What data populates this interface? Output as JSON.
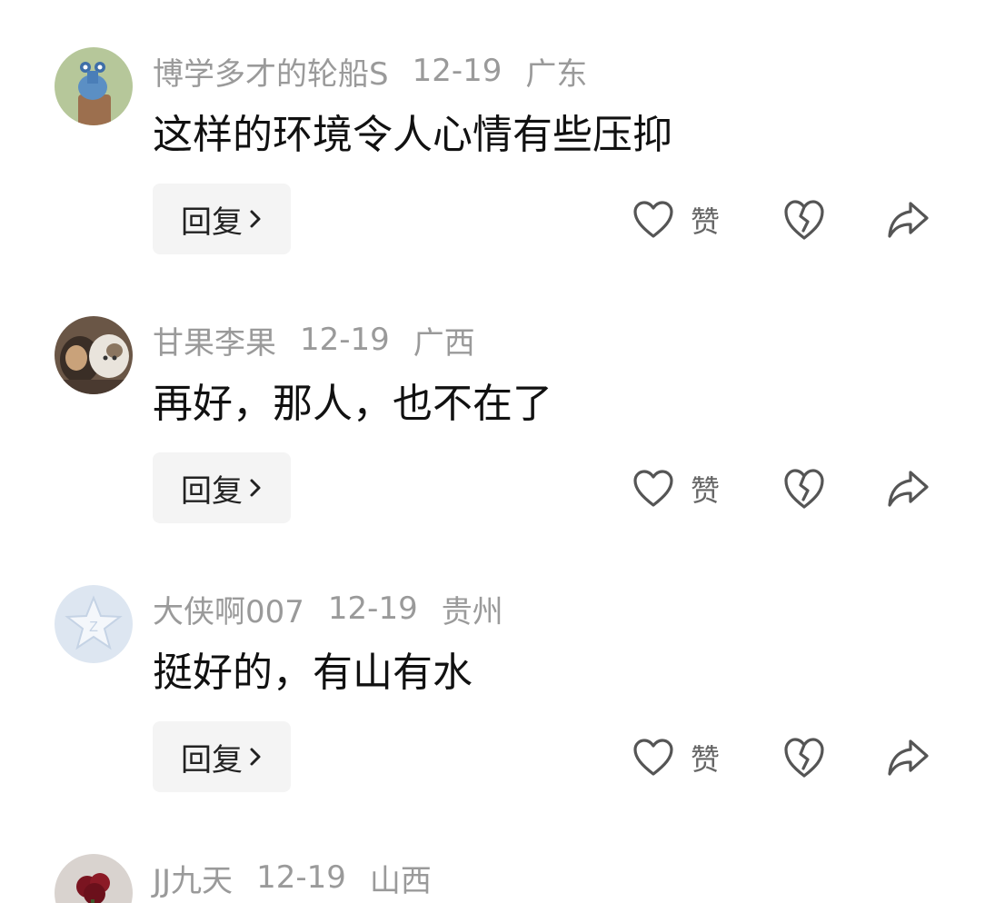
{
  "comments": [
    {
      "username": "博学多才的轮船S",
      "date": "12-19",
      "location": "广东",
      "text": "这样的环境令人心情有些压抑",
      "reply_label": "回复",
      "like_label": "赞",
      "avatar_icon": "snail-plant-avatar"
    },
    {
      "username": "甘果李果",
      "date": "12-19",
      "location": "广西",
      "text": "再好，那人，也不在了",
      "reply_label": "回复",
      "like_label": "赞",
      "avatar_icon": "cats-photo-avatar"
    },
    {
      "username": "大侠啊007",
      "date": "12-19",
      "location": "贵州",
      "text": "挺好的，有山有水",
      "reply_label": "回复",
      "like_label": "赞",
      "avatar_icon": "default-star-avatar"
    },
    {
      "username": "JJ九天",
      "date": "12-19",
      "location": "山西",
      "avatar_icon": "flower-photo-avatar"
    }
  ],
  "colors": {
    "meta_text": "#9a9a9a",
    "body_text": "#111111",
    "button_bg": "#f4f4f4",
    "icon_stroke": "#555555"
  }
}
